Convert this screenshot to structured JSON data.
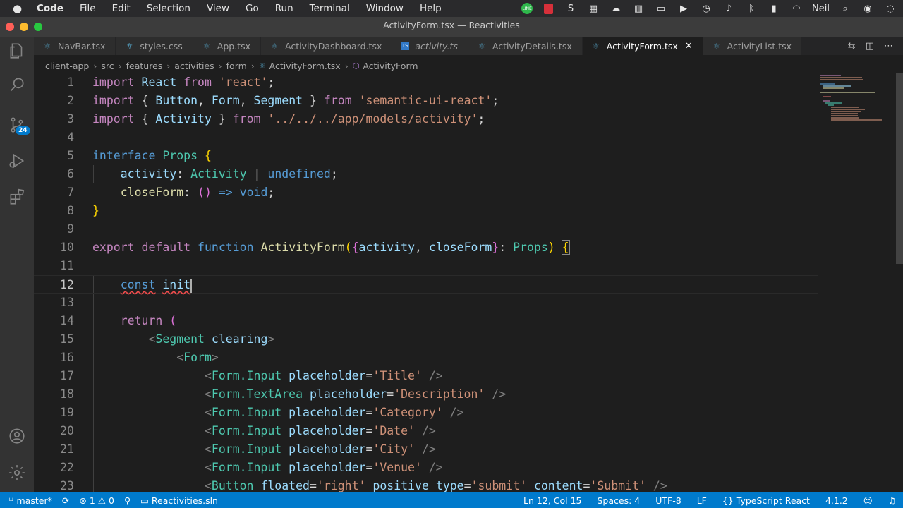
{
  "menubar": {
    "apple": "",
    "items": [
      "Code",
      "File",
      "Edit",
      "Selection",
      "View",
      "Go",
      "Run",
      "Terminal",
      "Window",
      "Help"
    ],
    "user": "Neil"
  },
  "window": {
    "title": "ActivityForm.tsx — Reactivities"
  },
  "activitybar": {
    "scm_badge": "24"
  },
  "tabs": [
    {
      "label": "NavBar.tsx",
      "icon": "react-icon",
      "italic": false,
      "active": false
    },
    {
      "label": "styles.css",
      "icon": "css-icon",
      "italic": false,
      "active": false
    },
    {
      "label": "App.tsx",
      "icon": "react-icon",
      "italic": false,
      "active": false
    },
    {
      "label": "ActivityDashboard.tsx",
      "icon": "react-icon",
      "italic": false,
      "active": false
    },
    {
      "label": "activity.ts",
      "icon": "ts-icon",
      "italic": true,
      "active": false
    },
    {
      "label": "ActivityDetails.tsx",
      "icon": "react-icon",
      "italic": false,
      "active": false
    },
    {
      "label": "ActivityForm.tsx",
      "icon": "react-icon",
      "italic": false,
      "active": true
    },
    {
      "label": "ActivityList.tsx",
      "icon": "react-icon",
      "italic": false,
      "active": false
    }
  ],
  "breadcrumb": [
    "client-app",
    "src",
    "features",
    "activities",
    "form",
    "ActivityForm.tsx",
    "ActivityForm"
  ],
  "editor": {
    "line_numbers": [
      "1",
      "2",
      "3",
      "4",
      "5",
      "6",
      "7",
      "8",
      "9",
      "10",
      "11",
      "12",
      "13",
      "14",
      "15",
      "16",
      "17",
      "18",
      "19",
      "20",
      "21",
      "22",
      "23"
    ],
    "current_line": 12
  },
  "status": {
    "branch": "master*",
    "errors": "1",
    "warnings": "0",
    "solution": "Reactivities.sln",
    "position": "Ln 12, Col 15",
    "spaces": "Spaces: 4",
    "encoding": "UTF-8",
    "eol": "LF",
    "language": "TypeScript React",
    "ts_version": "4.1.2"
  },
  "colors": {
    "accent": "#007acc",
    "background": "#1e1e1e"
  }
}
